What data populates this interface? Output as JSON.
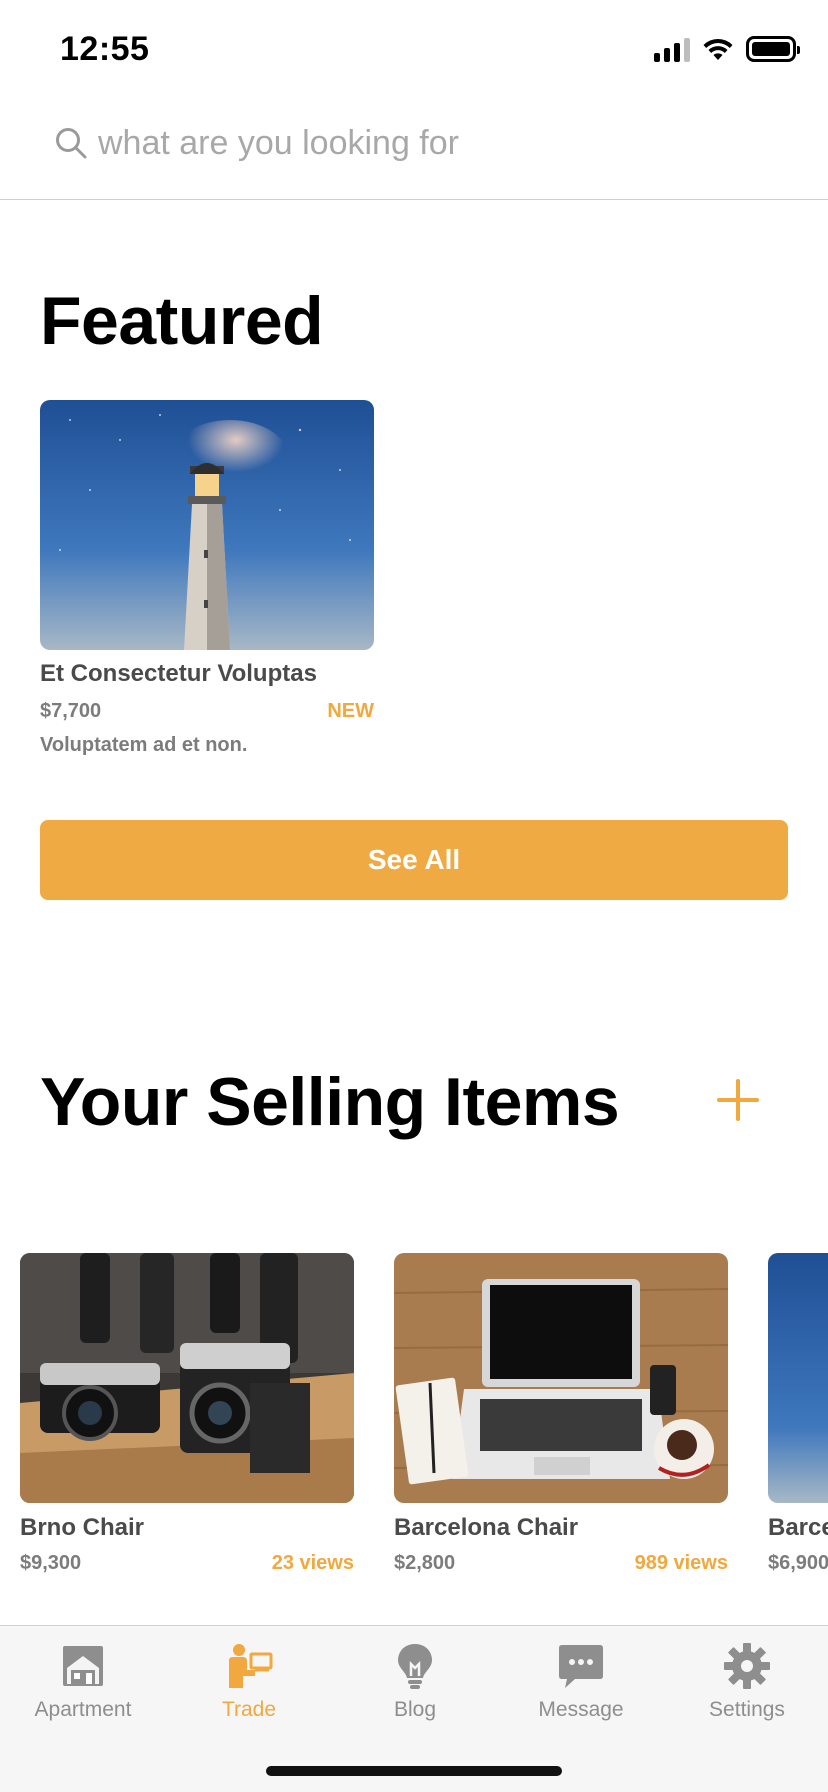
{
  "status_bar": {
    "time": "12:55"
  },
  "search": {
    "placeholder": "what are you looking for",
    "value": ""
  },
  "featured": {
    "title": "Featured",
    "items": [
      {
        "name": "Et Consectetur Voluptas",
        "price": "$7,700",
        "tag": "NEW",
        "description": "Voluptatem ad et non.",
        "image": "lighthouse-night-photo"
      }
    ],
    "see_all_label": "See All"
  },
  "selling": {
    "title": "Your Selling Items",
    "items": [
      {
        "name": "Brno Chair",
        "price": "$9,300",
        "views": "23 views",
        "image": "vintage-cameras-photo"
      },
      {
        "name": "Barcelona Chair",
        "price": "$2,800",
        "views": "989 views",
        "image": "laptop-desk-photo"
      },
      {
        "name": "Barcelona Chair",
        "price": "$6,900",
        "views": "",
        "image": "sky-photo"
      }
    ]
  },
  "tabs": [
    {
      "label": "Apartment",
      "icon": "apartment-icon",
      "active": false
    },
    {
      "label": "Trade",
      "icon": "trade-icon",
      "active": true
    },
    {
      "label": "Blog",
      "icon": "lightbulb-icon",
      "active": false
    },
    {
      "label": "Message",
      "icon": "message-icon",
      "active": false
    },
    {
      "label": "Settings",
      "icon": "gear-icon",
      "active": false
    }
  ],
  "colors": {
    "accent": "#f0aa43",
    "inactive": "#8e8e8e"
  }
}
